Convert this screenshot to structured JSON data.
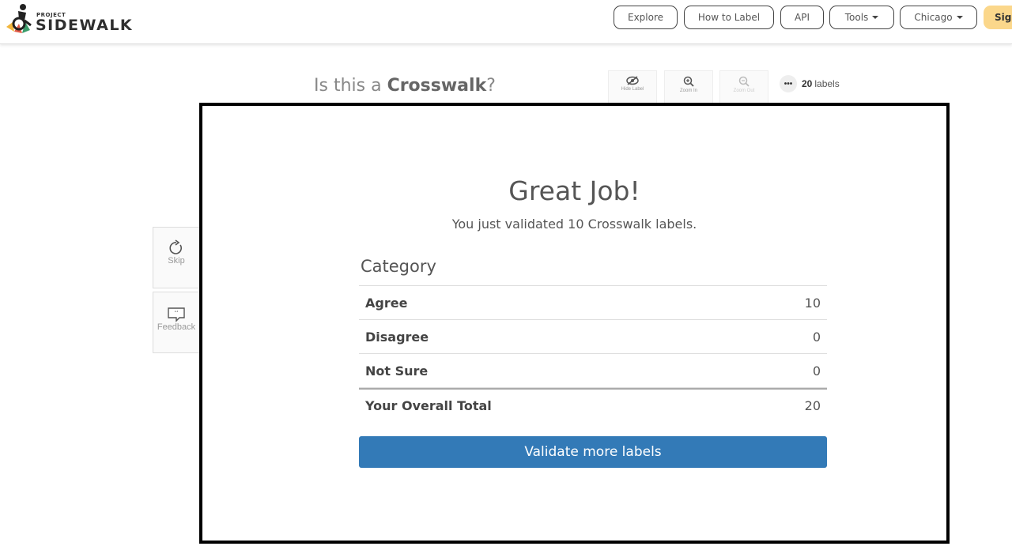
{
  "brand": {
    "line1": "PROJECT",
    "line2": "SIDEWALK"
  },
  "nav": {
    "items": [
      {
        "label": "Explore"
      },
      {
        "label": "How to Label"
      },
      {
        "label": "API"
      },
      {
        "label": "Tools"
      },
      {
        "label": "Chicago"
      }
    ],
    "signin": "Sig"
  },
  "question": {
    "prefix": "Is this a ",
    "label_type": "Crosswalk",
    "suffix": "?"
  },
  "tools": {
    "hide_label": "Hide Label",
    "zoom_in": "Zoom In",
    "zoom_out": "Zoom Out",
    "labels_count": "20",
    "labels_word": "labels"
  },
  "side": {
    "skip": "Skip",
    "feedback": "Feedback"
  },
  "modal": {
    "title": "Great Job!",
    "subtitle": "You just validated 10 Crosswalk labels.",
    "table_header": "Category",
    "rows": [
      {
        "label": "Agree",
        "value": "10"
      },
      {
        "label": "Disagree",
        "value": "0"
      },
      {
        "label": "Not Sure",
        "value": "0"
      }
    ],
    "total": {
      "label": "Your Overall Total",
      "value": "20"
    },
    "cta": "Validate more labels"
  }
}
